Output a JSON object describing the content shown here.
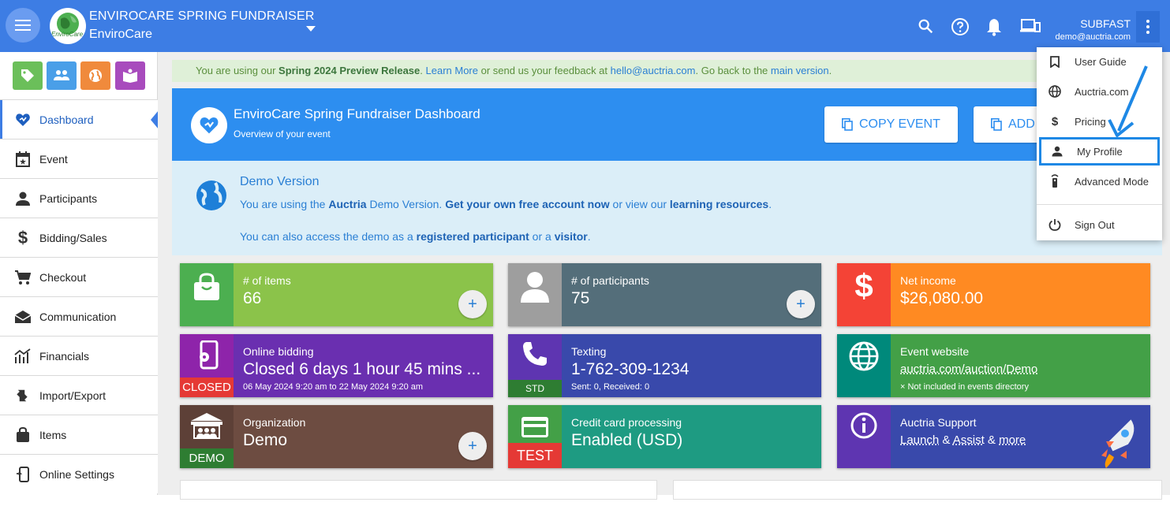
{
  "header": {
    "title": "ENVIROCARE SPRING FUNDRAISER",
    "org": "EnviroCare",
    "logo_text": "EnviroCare",
    "user_name": "SUBFAST",
    "user_email": "demo@auctria.com"
  },
  "sidebar": {
    "quick_buttons": [
      {
        "icon": "tag-icon",
        "color": "#6bbf5a"
      },
      {
        "icon": "people-icon",
        "color": "#4a9fe8"
      },
      {
        "icon": "globe-icon",
        "color": "#f08a3c"
      },
      {
        "icon": "book-icon",
        "color": "#a84bbd"
      }
    ],
    "items": [
      {
        "label": "Dashboard",
        "icon": "dashboard-heart-icon"
      },
      {
        "label": "Event",
        "icon": "calendar-icon"
      },
      {
        "label": "Participants",
        "icon": "person-icon"
      },
      {
        "label": "Bidding/Sales",
        "icon": "dollar-icon"
      },
      {
        "label": "Checkout",
        "icon": "cart-icon"
      },
      {
        "label": "Communication",
        "icon": "mail-icon"
      },
      {
        "label": "Financials",
        "icon": "chart-icon"
      },
      {
        "label": "Import/Export",
        "icon": "import-export-icon"
      },
      {
        "label": "Items",
        "icon": "bag-icon"
      },
      {
        "label": "Online Settings",
        "icon": "phone-settings-icon"
      }
    ]
  },
  "notice": {
    "prefix": "You are using our ",
    "release": "Spring 2024 Preview Release",
    "dot": ". ",
    "learn_more": "Learn More",
    "mid": " or send us your feedback at ",
    "email": "hello@auctria.com",
    "mid2": ". Go back to the ",
    "main_version": "main version",
    "end": "."
  },
  "banner": {
    "title": "EnviroCare Spring Fundraiser Dashboard",
    "subtitle": "Overview of your event",
    "copy_label": "COPY EVENT",
    "add_label": "ADD"
  },
  "demo": {
    "title": "Demo Version",
    "l1_a": "You are using the ",
    "l1_b": "Auctria",
    "l1_c": " Demo Version. ",
    "l1_d": "Get your own free account now",
    "l1_e": " or view our ",
    "l1_f": "learning resources",
    "l1_g": ".",
    "l2_a": "You can also access the demo as a ",
    "l2_b": "registered participant",
    "l2_c": " or a ",
    "l2_d": "visitor",
    "l2_e": "."
  },
  "tiles": {
    "items": {
      "label": "# of items",
      "value": "66"
    },
    "participants": {
      "label": "# of participants",
      "value": "75"
    },
    "income": {
      "label": "Net income",
      "value": "$26,080.00"
    },
    "bidding": {
      "label": "Online bidding",
      "value": "Closed 6 days 1 hour 45 mins ...",
      "sub": "06 May 2024 9:20 am to 22 May 2024 9:20 am",
      "badge": "CLOSED"
    },
    "texting": {
      "label": "Texting",
      "value": "1-762-309-1234",
      "sub": "Sent: 0, Received: 0",
      "badge": "STD"
    },
    "website": {
      "label": "Event website",
      "value": "auctria.com/auction/Demo",
      "sub": "× Not included in events directory"
    },
    "organization": {
      "label": "Organization",
      "value": "Demo",
      "badge": "DEMO"
    },
    "credit": {
      "label": "Credit card processing",
      "value": "Enabled (USD)",
      "badge": "TEST"
    },
    "support": {
      "label": "Auctria Support",
      "launch": "Launch",
      "amp1": " & ",
      "assist": "Assist",
      "amp2": " & ",
      "more": "more"
    }
  },
  "dropdown": {
    "items": [
      {
        "label": "User Guide",
        "icon": "bookmark-icon"
      },
      {
        "label": "Auctria.com",
        "icon": "globe-icon"
      },
      {
        "label": "Pricing",
        "icon": "dollar-icon"
      },
      {
        "label": "My Profile",
        "icon": "person-icon"
      },
      {
        "label": "Advanced Mode",
        "icon": "remote-icon"
      },
      {
        "label": "Sign Out",
        "icon": "power-icon"
      }
    ]
  }
}
